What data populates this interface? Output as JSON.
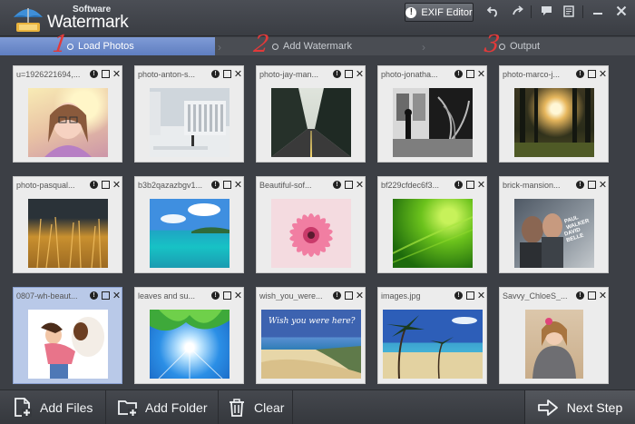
{
  "app": {
    "title_small": "Software",
    "title": "Watermark"
  },
  "toolbar": {
    "exif_label": "EXIF Editor"
  },
  "steps": [
    {
      "num": "1",
      "label": "Load Photos"
    },
    {
      "num": "2",
      "label": "Add Watermark"
    },
    {
      "num": "3",
      "label": "Output"
    }
  ],
  "photos": [
    {
      "name": "u=1926221694,...",
      "theme": "girl-bokeh"
    },
    {
      "name": "photo-anton-s...",
      "theme": "snow-buildings"
    },
    {
      "name": "photo-jay-man...",
      "theme": "forest-road"
    },
    {
      "name": "photo-jonatha...",
      "theme": "bw-street"
    },
    {
      "name": "photo-marco-j...",
      "theme": "sunlit-forest"
    },
    {
      "name": "photo-pasqual...",
      "theme": "golden-grass"
    },
    {
      "name": "b3b2qazazbgv1...",
      "theme": "tropical-sea"
    },
    {
      "name": "Beautiful-sof...",
      "theme": "pink-flower"
    },
    {
      "name": "bf229cfdec6f3...",
      "theme": "green-abstract"
    },
    {
      "name": "brick-mansion...",
      "theme": "movie-poster"
    },
    {
      "name": "0807-wh-beaut...",
      "theme": "girl-dog"
    },
    {
      "name": "leaves and su...",
      "theme": "leaves-sun"
    },
    {
      "name": "wish_you_were...",
      "theme": "beach-card"
    },
    {
      "name": "images.jpg",
      "theme": "palm-beach"
    },
    {
      "name": "Savvy_ChloeS_...",
      "theme": "girl-blanket"
    }
  ],
  "poster_text": [
    "PAUL WALKER",
    "DAVID BELLE"
  ],
  "postcard_text": "Wish you were here?",
  "bottom": {
    "add_files": "Add Files",
    "add_folder": "Add Folder",
    "clear": "Clear",
    "next": "Next Step"
  }
}
